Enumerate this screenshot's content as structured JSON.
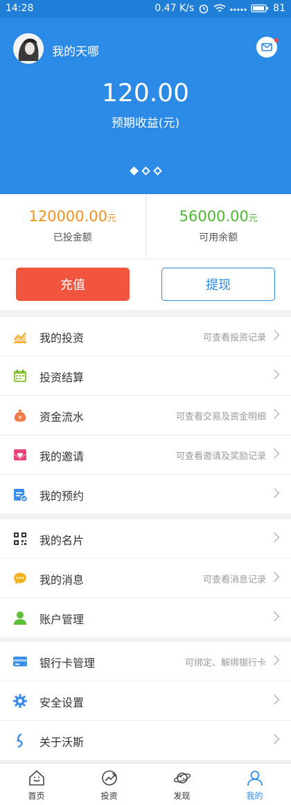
{
  "status": {
    "time": "14:28",
    "speed": "0.47 K/s",
    "battery": "81"
  },
  "hero": {
    "username": "我的天哪",
    "earnings": "120.00",
    "earnings_label": "预期收益(元)",
    "carousel_active": 0,
    "carousel_count": 3
  },
  "stats": {
    "invested": {
      "value": "120000.00",
      "unit": "元",
      "label": "已投金额",
      "color": "#f5901e"
    },
    "available": {
      "value": "56000.00",
      "unit": "元",
      "label": "可用余额",
      "color": "#4db831"
    }
  },
  "actions": {
    "recharge": "充值",
    "withdraw": "提现"
  },
  "menu": {
    "group1": [
      {
        "icon": "chart-icon",
        "label": "我的投资",
        "hint": "可查看投资记录"
      },
      {
        "icon": "calendar-icon",
        "label": "投资结算",
        "hint": ""
      },
      {
        "icon": "money-bag-icon",
        "label": "资金流水",
        "hint": "可查看交易及资金明细"
      },
      {
        "icon": "invite-icon",
        "label": "我的邀请",
        "hint": "可查看邀请及奖励记录"
      },
      {
        "icon": "schedule-icon",
        "label": "我的预约",
        "hint": ""
      }
    ],
    "group2": [
      {
        "icon": "qrcode-icon",
        "label": "我的名片",
        "hint": ""
      },
      {
        "icon": "message-icon",
        "label": "我的消息",
        "hint": "可查看消息记录"
      },
      {
        "icon": "user-icon",
        "label": "账户管理",
        "hint": ""
      }
    ],
    "group3": [
      {
        "icon": "bank-card-icon",
        "label": "银行卡管理",
        "hint": "可绑定、解绑银行卡"
      },
      {
        "icon": "gear-icon",
        "label": "安全设置",
        "hint": ""
      },
      {
        "icon": "about-icon",
        "label": "关于沃斯",
        "hint": ""
      }
    ]
  },
  "tabs": [
    {
      "label": "首页",
      "icon": "home-icon"
    },
    {
      "label": "投资",
      "icon": "invest-icon"
    },
    {
      "label": "发现",
      "icon": "planet-icon"
    },
    {
      "label": "我的",
      "icon": "profile-icon",
      "active": true
    }
  ],
  "colors": {
    "primary": "#2b8ae6",
    "recharge": "#f2553d"
  }
}
